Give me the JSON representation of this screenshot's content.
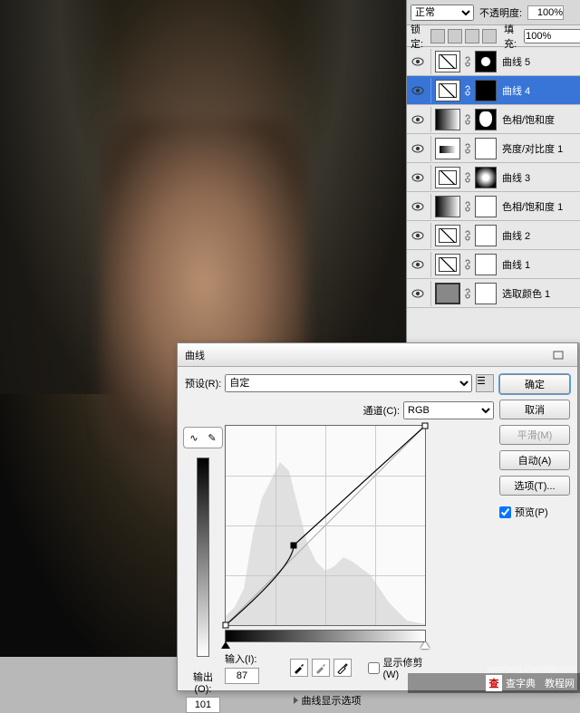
{
  "layers_panel": {
    "blend_mode": "正常",
    "opacity_label": "不透明度:",
    "opacity_value": "100%",
    "lock_label": "锁定:",
    "fill_label": "填充:",
    "fill_value": "100%",
    "layers": [
      {
        "name": "曲线 5",
        "type": "curves",
        "mask": "dot",
        "selected": false
      },
      {
        "name": "曲线 4",
        "type": "curves",
        "mask": "black",
        "selected": true
      },
      {
        "name": "色相/饱和度",
        "type": "grad",
        "mask": "shape",
        "selected": false
      },
      {
        "name": "亮度/对比度 1",
        "type": "levels",
        "mask": "white",
        "selected": false
      },
      {
        "name": "曲线 3",
        "type": "curves",
        "mask": "soft",
        "selected": false
      },
      {
        "name": "色相/饱和度 1",
        "type": "grad",
        "mask": "white",
        "selected": false
      },
      {
        "name": "曲线 2",
        "type": "curves",
        "mask": "white",
        "selected": false
      },
      {
        "name": "曲线 1",
        "type": "curves",
        "mask": "white",
        "selected": false
      },
      {
        "name": "选取颜色 1",
        "type": "solid",
        "mask": "white",
        "selected": false
      }
    ]
  },
  "dialog": {
    "title": "曲线",
    "preset_label": "预设(R):",
    "preset_value": "自定",
    "channel_label": "通道(C):",
    "channel_value": "RGB",
    "output_label": "输出(O):",
    "output_value": "101",
    "input_label": "输入(I):",
    "input_value": "87",
    "clip_label": "显示修剪(W)",
    "expand_label": "曲线显示选项",
    "buttons": {
      "ok": "确定",
      "cancel": "取消",
      "smooth": "平滑(M)",
      "auto": "自动(A)",
      "options": "选项(T)..."
    },
    "preview_label": "预览(P)"
  },
  "watermark": {
    "logo": "查",
    "text1": "查字典",
    "text2": "教程网",
    "url": "jiaocheng.chazidian.com"
  }
}
